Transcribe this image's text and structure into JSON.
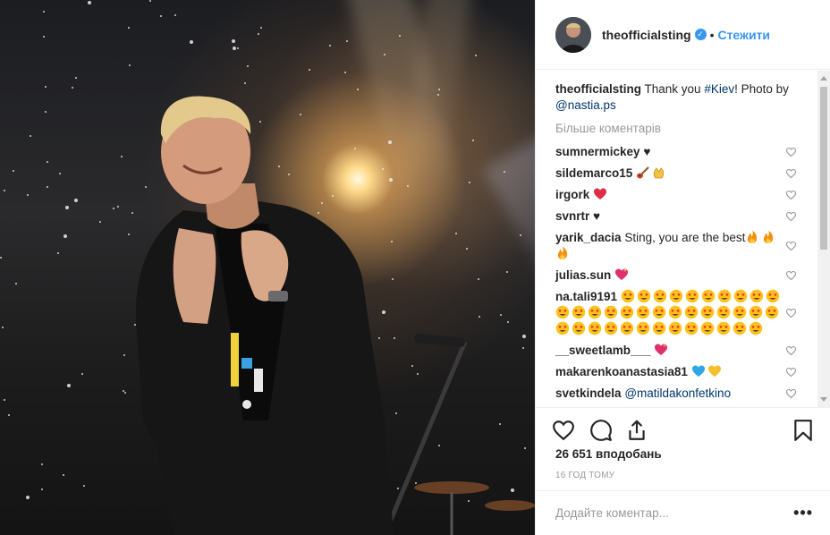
{
  "header": {
    "username": "theofficialsting",
    "verified_mark": "✓",
    "separator": "•",
    "follow_label": "Стежити"
  },
  "caption": {
    "username": "theofficialsting",
    "text_prefix": "Thank you ",
    "hashtag": "#Kiev",
    "text_middle": "! Photo by",
    "mention": "@nastia.ps"
  },
  "more_comments_label": "Більше коментарів",
  "comments": [
    {
      "username": "sumnermickey",
      "text": "♥",
      "emojis": []
    },
    {
      "username": "sildemarco15",
      "text": "",
      "emojis": [
        "guitar",
        "clap"
      ]
    },
    {
      "username": "irgork",
      "text": "",
      "emojis": [
        "red-heart"
      ]
    },
    {
      "username": "svnrtr",
      "text": "♥",
      "emojis": []
    },
    {
      "username": "yarik_dacia",
      "text": "Sting, you are the best",
      "emojis": [
        "fire",
        "fire",
        "fire"
      ]
    },
    {
      "username": "julias.sun",
      "text": "",
      "emojis": [
        "sparkling-heart"
      ]
    },
    {
      "username": "na.tali9191",
      "text": "",
      "emojis_count": 37,
      "emoji": "star-struck"
    },
    {
      "username": "__sweetlamb___",
      "text": "",
      "emojis": [
        "sparkling-heart"
      ]
    },
    {
      "username": "makarenkoanastasia81",
      "text": "",
      "emojis": [
        "blue-heart",
        "yellow-heart"
      ]
    },
    {
      "username": "svetkindela",
      "text": "@matildakonfetkino",
      "emojis": []
    }
  ],
  "actions": {
    "like_icon": "heart-icon",
    "comment_icon": "comment-icon",
    "share_icon": "share-icon",
    "save_icon": "bookmark-icon"
  },
  "likes": "26 651 вподобань",
  "timestamp": "16 ГОД ТОМУ",
  "add_comment": {
    "placeholder": "Додайте коментар...",
    "options_label": "•••"
  },
  "colors": {
    "accent": "#3897f0",
    "link": "#003569",
    "muted": "#999999",
    "border": "#efefef"
  }
}
